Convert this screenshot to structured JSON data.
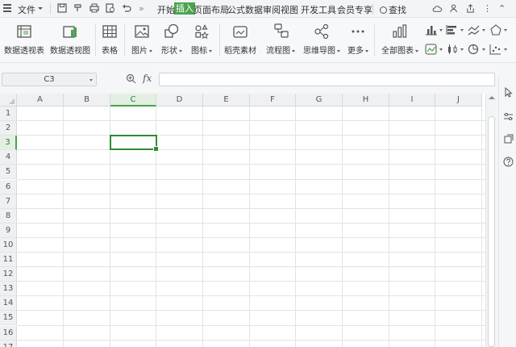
{
  "menubar": {
    "file_label": "文件",
    "tabs": [
      {
        "label": "开始",
        "active": false
      },
      {
        "label": "插入",
        "active": true
      },
      {
        "label": "页面布局",
        "active": false
      },
      {
        "label": "公式",
        "active": false
      },
      {
        "label": "数据",
        "active": false
      },
      {
        "label": "审阅",
        "active": false
      },
      {
        "label": "视图",
        "active": false
      },
      {
        "label": "开发工具",
        "active": false
      },
      {
        "label": "会员专享",
        "active": false
      }
    ],
    "find_label": "查找",
    "accent_color": "#4aa34e"
  },
  "ribbon": {
    "items": [
      {
        "label": "数据透视表",
        "icon": "pivot-table-icon"
      },
      {
        "label": "数据透视图",
        "icon": "pivot-chart-icon"
      },
      {
        "label": "表格",
        "icon": "table-icon"
      },
      {
        "label": "图片",
        "icon": "picture-icon"
      },
      {
        "label": "形状",
        "icon": "shape-icon"
      },
      {
        "label": "图标",
        "icon": "icons-icon"
      },
      {
        "label": "稻壳素材",
        "icon": "docer-material-icon"
      },
      {
        "label": "流程图",
        "icon": "flowchart-icon"
      },
      {
        "label": "思维导图",
        "icon": "mindmap-icon"
      },
      {
        "label": "更多",
        "icon": "more-icon"
      },
      {
        "label": "全部图表",
        "icon": "all-charts-icon"
      }
    ]
  },
  "formula_bar": {
    "name_box": "C3",
    "fx_label": "fx",
    "formula": ""
  },
  "sheet": {
    "columns": [
      "A",
      "B",
      "C",
      "D",
      "E",
      "F",
      "G",
      "H",
      "I",
      "J"
    ],
    "rows": [
      "1",
      "2",
      "3",
      "4",
      "5",
      "6",
      "7",
      "8",
      "9",
      "10",
      "11",
      "12",
      "13",
      "14",
      "15",
      "16",
      "17"
    ],
    "selected_column": "C",
    "selected_row": "3",
    "selection_color": "#2e8b37"
  }
}
